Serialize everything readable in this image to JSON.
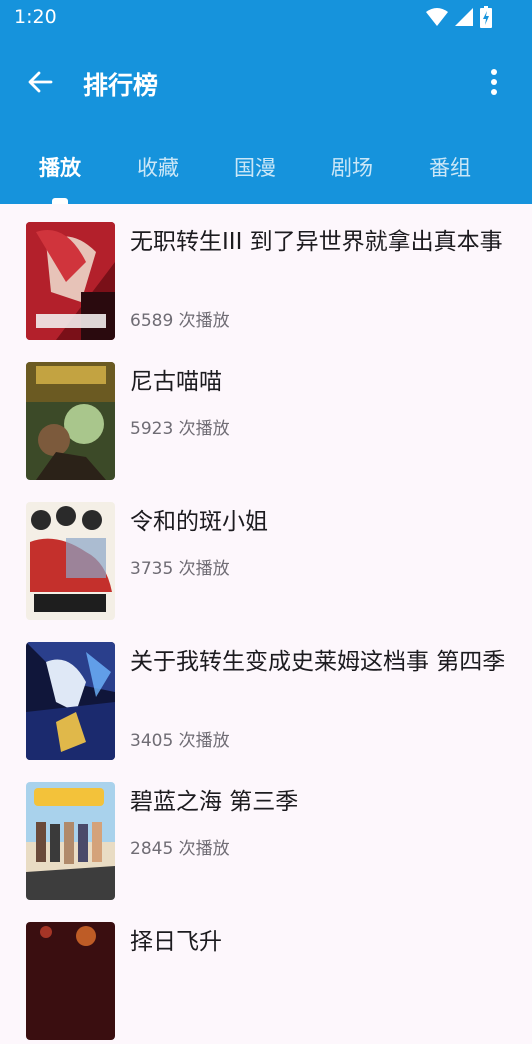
{
  "status": {
    "time": "1:20"
  },
  "toolbar": {
    "title": "排行榜"
  },
  "tabs": [
    {
      "label": "播放"
    },
    {
      "label": "收藏"
    },
    {
      "label": "国漫"
    },
    {
      "label": "剧场"
    },
    {
      "label": "番组"
    }
  ],
  "items": [
    {
      "title": "无职转生III 到了异世界就拿出真本事",
      "count": "6589 次播放"
    },
    {
      "title": "尼古喵喵",
      "count": "5923 次播放"
    },
    {
      "title": "令和的斑小姐",
      "count": "3735 次播放"
    },
    {
      "title": "关于我转生变成史莱姆这档事 第四季",
      "count": "3405 次播放"
    },
    {
      "title": "碧蓝之海 第三季",
      "count": "2845 次播放"
    },
    {
      "title": "择日飞升",
      "count": ""
    }
  ],
  "colors": {
    "appbar": "#1693dc",
    "background": "#fdf7fc"
  }
}
